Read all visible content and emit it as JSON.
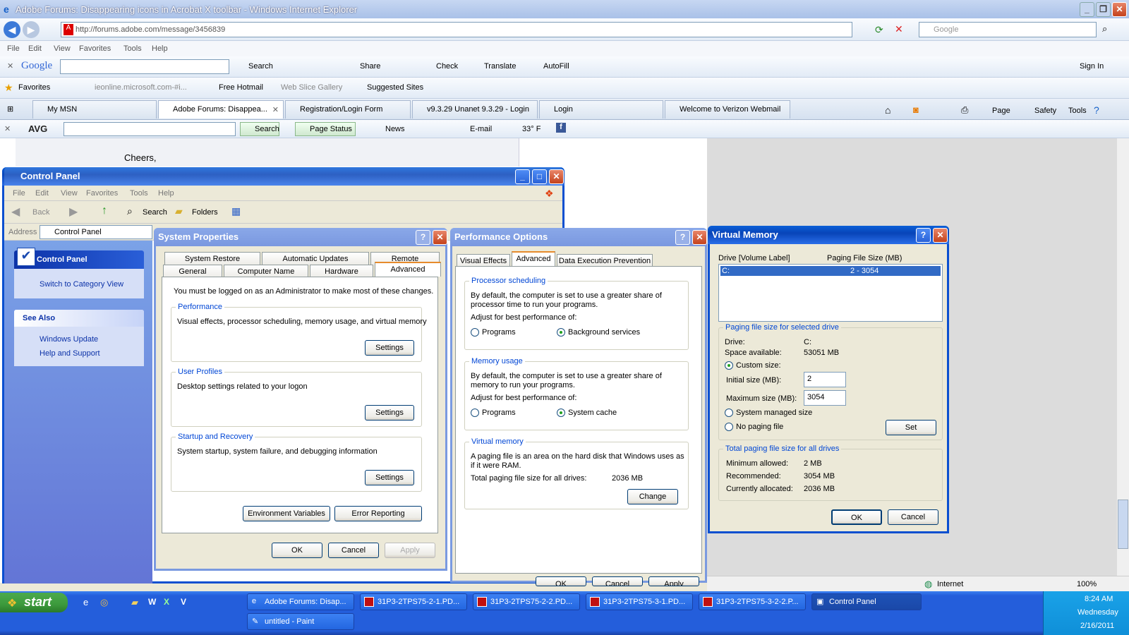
{
  "ie": {
    "title": "Adobe Forums: Disappearing icons in Acrobat X toolbar - Windows Internet Explorer",
    "address": "http://forums.adobe.com/message/3456839",
    "search_placeholder": "Google",
    "menu": [
      "File",
      "Edit",
      "View",
      "Favorites",
      "Tools",
      "Help"
    ],
    "google_bar": {
      "logo": "Google",
      "search": "Search",
      "share": "Share",
      "check": "Check",
      "translate": "Translate",
      "autofill": "AutoFill",
      "sign_in": "Sign In"
    },
    "favorites": {
      "label": "Favorites",
      "items": [
        "ieonline.microsoft.com-#i...",
        "Free Hotmail",
        "Web Slice Gallery",
        "Suggested Sites"
      ]
    },
    "tabs": [
      "My MSN",
      "Adobe Forums: Disappea...",
      "Registration/Login Form",
      "v9.3.29 Unanet 9.3.29 - Login",
      "Login",
      "Welcome to Verizon Webmail"
    ],
    "cmd": [
      "Page",
      "Safety",
      "Tools"
    ],
    "avg": {
      "logo": "AVG",
      "search": "Search",
      "page_status": "Page Status",
      "news": "News",
      "email": "E-mail",
      "temp": "33° F"
    },
    "page_text": "Cheers,",
    "status": {
      "zone": "Internet",
      "zoom": "100%"
    }
  },
  "cp": {
    "title": "Control Panel",
    "menu": [
      "File",
      "Edit",
      "View",
      "Favorites",
      "Tools",
      "Help"
    ],
    "back": "Back",
    "search": "Search",
    "folders": "Folders",
    "address_label": "Address",
    "address": "Control Panel",
    "panel_title": "Control Panel",
    "switch": "Switch to Category View",
    "see_also": "See Also",
    "links": [
      "Windows Update",
      "Help and Support"
    ]
  },
  "sysprop": {
    "title": "System Properties",
    "tabs_top": [
      "System Restore",
      "Automatic Updates",
      "Remote"
    ],
    "tabs_bottom": [
      "General",
      "Computer Name",
      "Hardware",
      "Advanced"
    ],
    "notice": "You must be logged on as an Administrator to make most of these changes.",
    "perf": {
      "title": "Performance",
      "desc": "Visual effects, processor scheduling, memory usage, and virtual memory",
      "btn": "Settings"
    },
    "profiles": {
      "title": "User Profiles",
      "desc": "Desktop settings related to your logon",
      "btn": "Settings"
    },
    "startup": {
      "title": "Startup and Recovery",
      "desc": "System startup, system failure, and debugging information",
      "btn": "Settings"
    },
    "env": "Environment Variables",
    "err": "Error Reporting",
    "ok": "OK",
    "cancel": "Cancel",
    "apply": "Apply"
  },
  "perfopt": {
    "title": "Performance Options",
    "tabs": [
      "Visual Effects",
      "Advanced",
      "Data Execution Prevention"
    ],
    "proc": {
      "title": "Processor scheduling",
      "desc1": "By default, the computer is set to use a greater share of",
      "desc2": "processor time to run your programs.",
      "adjust": "Adjust for best performance of:",
      "opt1": "Programs",
      "opt2": "Background services"
    },
    "mem": {
      "title": "Memory usage",
      "desc1": "By default, the computer is set to use a greater share of",
      "desc2": "memory to run your programs.",
      "adjust": "Adjust for best performance of:",
      "opt1": "Programs",
      "opt2": "System cache"
    },
    "vm": {
      "title": "Virtual memory",
      "desc1": "A paging file is an area on the hard disk that Windows uses as",
      "desc2": "if it were RAM.",
      "total_label": "Total paging file size for all drives:",
      "total": "2036 MB",
      "btn": "Change"
    },
    "ok": "OK",
    "cancel": "Cancel",
    "apply": "Apply"
  },
  "vm": {
    "title": "Virtual Memory",
    "col1": "Drive  [Volume Label]",
    "col2": "Paging File Size (MB)",
    "row_drive": "C:",
    "row_size": "2 - 3054",
    "sel": {
      "title": "Paging file size for selected drive",
      "drive_label": "Drive:",
      "drive": "C:",
      "space_label": "Space available:",
      "space": "53051 MB",
      "custom": "Custom size:",
      "initial_label": "Initial size (MB):",
      "initial": "2",
      "max_label": "Maximum size (MB):",
      "max": "3054",
      "system": "System managed size",
      "none": "No paging file",
      "set": "Set"
    },
    "total": {
      "title": "Total paging file size for all drives",
      "min_label": "Minimum allowed:",
      "min": "2 MB",
      "rec_label": "Recommended:",
      "rec": "3054 MB",
      "cur_label": "Currently allocated:",
      "cur": "2036 MB"
    },
    "ok": "OK",
    "cancel": "Cancel"
  },
  "taskbar": {
    "start": "start",
    "tasks": [
      "Adobe Forums: Disap...",
      "31P3-2TPS75-2-1.PD...",
      "31P3-2TPS75-2-2.PD...",
      "31P3-2TPS75-3-1.PD...",
      "31P3-2TPS75-3-2-2.P...",
      "Control Panel",
      "untitled - Paint"
    ],
    "time": "8:24 AM",
    "day": "Wednesday",
    "date": "2/16/2011"
  },
  "colors": {
    "xp_blue": "#0a5fd8",
    "taskbar": "#245edb",
    "start_green": "#3c9a3c"
  }
}
